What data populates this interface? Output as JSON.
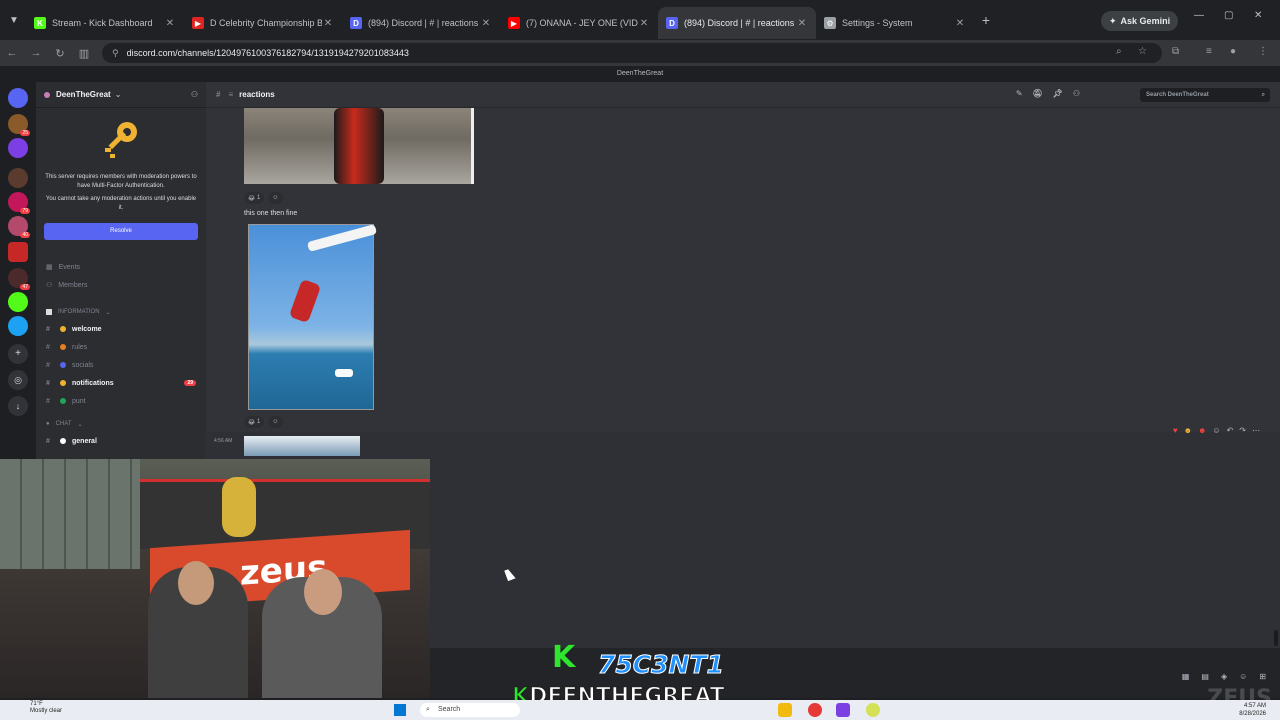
{
  "browser": {
    "tabs": [
      {
        "label": "Stream - Kick Dashboard",
        "fav_color": "#53fc18",
        "fav_glyph": "K",
        "active": false
      },
      {
        "label": "D Celebrity Championship Bo",
        "fav_color": "#e02424",
        "fav_glyph": "▶",
        "active": false
      },
      {
        "label": "(894) Discord | #  | reactions",
        "fav_color": "#5865f2",
        "fav_glyph": "D",
        "active": false
      },
      {
        "label": "(7) ONANA - JEY ONE (VIDEO C",
        "fav_color": "#ff0000",
        "fav_glyph": "▶",
        "active": false
      },
      {
        "label": "(894) Discord | #  | reactions",
        "fav_color": "#5865f2",
        "fav_glyph": "D",
        "active": true
      },
      {
        "label": "Settings - System",
        "fav_color": "#9aa0a6",
        "fav_glyph": "⚙",
        "active": false
      }
    ],
    "gemini_label": "Ask Gemini",
    "url": "discord.com/channels/1204976100376182794/1319194279201083443"
  },
  "discord": {
    "window_title": "DeenTheGreat",
    "server_name": "DeenTheGreat",
    "mfa_line1": "This server requires members with moderation powers to have Multi-Factor Authentication.",
    "mfa_line2": "You cannot take any moderation actions until you enable it.",
    "resolve_label": "Resolve",
    "nav": {
      "events": "Events",
      "members": "Members"
    },
    "category_info": "INFORMATION",
    "category_chat": "CHAT",
    "channels": [
      {
        "name": "welcome",
        "bold": true,
        "emo_color": "#f0b232"
      },
      {
        "name": "rules",
        "bold": false,
        "emo_color": "#e67e22"
      },
      {
        "name": "socials",
        "bold": false,
        "emo_color": "#5865f2"
      },
      {
        "name": "notifications",
        "bold": true,
        "emo_color": "#f0b232",
        "mentions": "29"
      },
      {
        "name": "punt",
        "bold": false,
        "emo_color": "#23a559"
      }
    ],
    "chat_channel": "general",
    "current_channel": "reactions",
    "search_placeholder": "Search DeenTheGreat",
    "message_text": "this one then fine",
    "reaction_count_1": "1",
    "reaction_count_2": "1",
    "message_time": "4:56 AM",
    "guild_badges": [
      "25",
      "79",
      "40",
      "47"
    ]
  },
  "overlay": {
    "k_letter": "K",
    "code": "75C3NT1",
    "name_k": "K",
    "name": "DEENTHEGREAT",
    "watermark": "ZEUS"
  },
  "webcam": {
    "banner_text": "zeus"
  },
  "taskbar": {
    "weather_temp": "71°F",
    "weather_desc": "Mostly clear",
    "search_label": "Search",
    "time": "4:57 AM",
    "date": "8/28/2026"
  }
}
